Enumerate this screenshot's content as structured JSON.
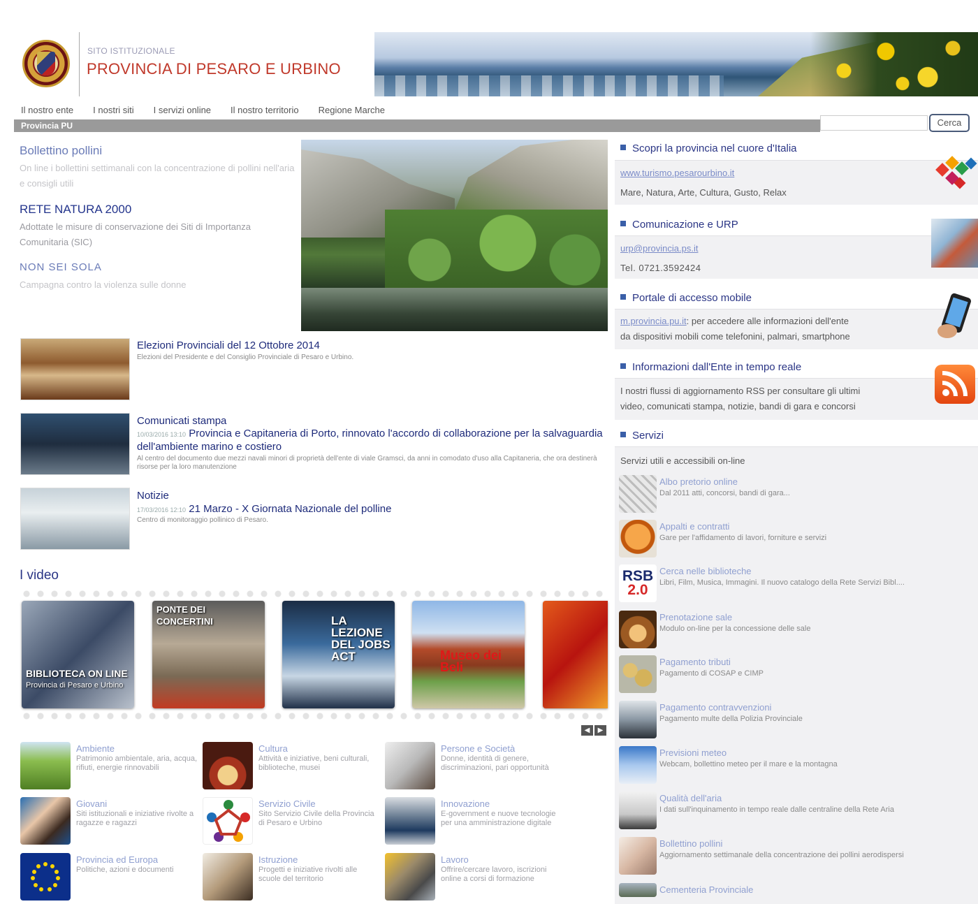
{
  "header": {
    "subtitle": "SITO ISTITUZIONALE",
    "title": "PROVINCIA DI PESARO E URBINO"
  },
  "nav": {
    "items": [
      "Il nostro ente",
      "I nostri siti",
      "I servizi online",
      "Il nostro territorio",
      "Regione Marche"
    ],
    "bar_label": "Provincia PU",
    "search_button": "Cerca",
    "search_value": ""
  },
  "features": [
    {
      "title": "Bollettino pollini",
      "desc": "On line i bollettini settimanali con la concentrazione di pollini nell'aria e consigli utili"
    },
    {
      "title": "RETE NATURA 2000",
      "desc": "Adottate le misure di conservazione dei Siti di Importanza Comunitaria (SIC)"
    },
    {
      "title": "NON SEI SOLA",
      "desc": "Campagna contro la violenza sulle donne"
    }
  ],
  "news": [
    {
      "heading": "Elezioni Provinciali del 12 Ottobre 2014",
      "date": "",
      "headline": "",
      "desc": "Elezioni del Presidente e del Consiglio Provinciale di Pesaro e Urbino."
    },
    {
      "heading": "Comunicati stampa",
      "date": "10/03/2016 13:10",
      "headline": "Provincia e Capitaneria di Porto, rinnovato l'accordo di collaborazione per la salvaguardia dell'ambiente marino e costiero",
      "desc": "Al centro del documento due mezzi navali minori di proprietà dell'ente di viale Gramsci, da anni in comodato d'uso alla Capitaneria, che ora destinerà risorse per la loro manutenzione"
    },
    {
      "heading": "Notizie",
      "date": "17/03/2016 12:10",
      "headline": "21 Marzo - X Giornata Nazionale del polline",
      "desc": "Centro di monitoraggio pollinico di Pesaro."
    }
  ],
  "videos": {
    "heading": "I video",
    "items": [
      {
        "caption": "BIBLIOTECA ON LINE",
        "sub": "Provincia di Pesaro e Urbino"
      },
      {
        "caption": "PONTE DEI CONCERTINI",
        "sub": ""
      },
      {
        "caption": "LA LEZIONE DEL JOBS ACT",
        "sub": ""
      },
      {
        "caption": "Museo dei Beli",
        "sub": ""
      },
      {
        "caption": "",
        "sub": ""
      }
    ]
  },
  "categories": [
    {
      "title": "Ambiente",
      "desc": "Patrimonio ambientale, aria, acqua, rifiuti, energie rinnovabili"
    },
    {
      "title": "Cultura",
      "desc": "Attività e iniziative, beni culturali, biblioteche, musei"
    },
    {
      "title": "Persone e Società",
      "desc": "Donne, identità di genere, discriminazioni, pari opportunità"
    },
    {
      "title": "Giovani",
      "desc": "Siti istituzionali e iniziative rivolte a ragazze e ragazzi"
    },
    {
      "title": "Servizio Civile",
      "desc": "Sito Servizio Civile della Provincia di Pesaro e Urbino"
    },
    {
      "title": "Innovazione",
      "desc": "E-government e nuove tecnologie per una amministrazione digitale"
    },
    {
      "title": "Provincia ed Europa",
      "desc": "Politiche, azioni e documenti"
    },
    {
      "title": "Istruzione",
      "desc": "Progetti e iniziative rivolti alle scuole del territorio"
    },
    {
      "title": "Lavoro",
      "desc": "Offrire/cercare lavoro, iscrizioni online a corsi di formazione"
    }
  ],
  "right": {
    "boxes": [
      {
        "title": "Scopri la provincia nel cuore d'Italia",
        "link": "www.turismo.pesarourbino.it",
        "text": "Mare, Natura, Arte, Cultura, Gusto, Relax"
      },
      {
        "title": "Comunicazione e URP",
        "link": "urp@provincia.ps.it",
        "text": "Tel. 0721.3592424"
      },
      {
        "title": "Portale di accesso mobile",
        "link": "m.provincia.pu.it",
        "text": ": per accedere alle informazioni dell'ente",
        "text2": "da dispositivi mobili come telefonini, palmari, smartphone"
      },
      {
        "title": "Informazioni dall'Ente in tempo reale",
        "text": "I nostri flussi di aggiornamento RSS per consultare gli ultimi",
        "text2": "video, comunicati stampa, notizie, bandi di gara e concorsi"
      }
    ],
    "services_title": "Servizi",
    "services_sub": "Servizi utili e accessibili on-line",
    "services": [
      {
        "title": "Albo pretorio online",
        "desc": "Dal 2011 atti, concorsi, bandi di gara..."
      },
      {
        "title": "Appalti e contratti",
        "desc": "Gare per l'affidamento di lavori, forniture e servizi"
      },
      {
        "title": "Cerca nelle biblioteche",
        "desc": "Libri, Film, Musica, Immagini. Il nuovo catalogo della Rete Servizi Bibl...."
      },
      {
        "title": "Prenotazione sale",
        "desc": "Modulo on-line per la concessione delle sale"
      },
      {
        "title": "Pagamento tributi",
        "desc": "Pagamento di COSAP e CIMP"
      },
      {
        "title": "Pagamento contravvenzioni",
        "desc": "Pagamento multe della Polizia Provinciale"
      },
      {
        "title": "Previsioni meteo",
        "desc": "Webcam, bollettino meteo per il mare e la montagna"
      },
      {
        "title": "Qualità dell'aria",
        "desc": "I dati sull'inquinamento in tempo reale dalle centraline della Rete Aria"
      },
      {
        "title": "Bollettino pollini",
        "desc": "Aggiornamento settimanale della concentrazione dei pollini aerodispersi"
      },
      {
        "title": "Cementeria Provinciale",
        "desc": ""
      }
    ],
    "rsb_line1": "RSB",
    "rsb_line2": "2.0"
  }
}
